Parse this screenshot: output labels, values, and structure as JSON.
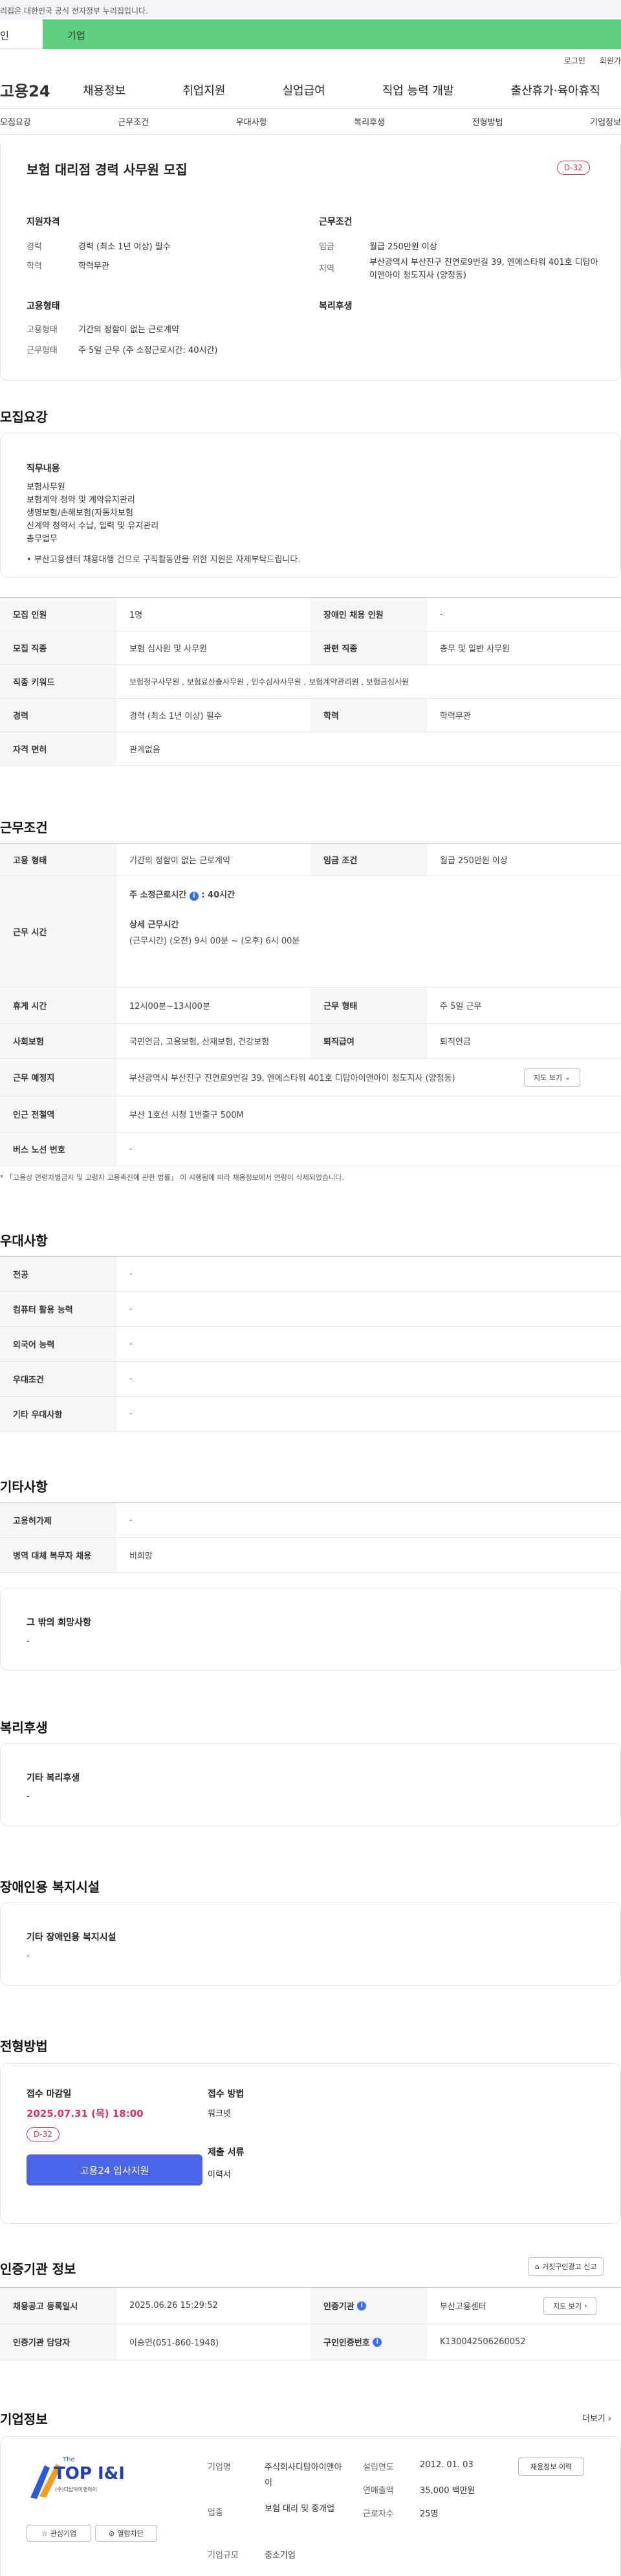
{
  "top": {
    "notice": "리집은 대한민국 공식 전자정부 누리집입니다.",
    "tab_individual": "인",
    "tab_company": "기업"
  },
  "util": {
    "login": "로그인",
    "join": "회원가"
  },
  "gnb": {
    "logo": "고용24",
    "items": [
      "채용정보",
      "취업지원",
      "실업급여",
      "직업 능력 개발",
      "출산휴가·육아휴직"
    ]
  },
  "subnav": [
    "모집요강",
    "근무조건",
    "우대사항",
    "복리후생",
    "전형방법",
    "기업정보"
  ],
  "summary": {
    "title": "보험 대리점 경력 사무원 모집",
    "dday": "D-32",
    "qual_head": "지원자격",
    "career_label": "경력",
    "career_value": "경력 (최소 1년 이상) 필수",
    "edu_label": "학력",
    "edu_value": "학력무관",
    "cond_head": "근무조건",
    "wage_label": "임금",
    "wage_value": "월급 250만원 이상",
    "region_label": "지역",
    "region_value": "부산광역시 부산진구 진연로9번길 39, 엔에스타워 401호 디탑아이앤아이 청도지사 (양정동)",
    "emp_head": "고용형태",
    "emp_label": "고용형태",
    "emp_value": "기간의 정함이 없는 근로계약",
    "hours_label": "근무형태",
    "hours_value": "주 5일 근무 (주 소정근로시간: 40시간)",
    "welfare_head": "복리후생"
  },
  "recruit": {
    "title": "모집요강",
    "duty_head": "직무내용",
    "duties": [
      "보험사무원",
      "보험계약 청약 및 계약유지관리",
      "생명보험/손해보험(자동차보험",
      "신계약 청약서 수납, 입력 및 유지관리",
      "총무업무"
    ],
    "notice": "• 부산고용센터 채용대행 건으로 구직활동만을 위한 지원은 자제부탁드립니다.",
    "rows": [
      [
        "모집 인원",
        "1명",
        "장애인 채용 인원",
        "-"
      ],
      [
        "모집 직종",
        "보험 심사원 및 사무원",
        "관련 직종",
        "총무 및 일반 사무원"
      ],
      [
        "직종 키워드",
        "보험청구사무원 , 보험료산출사무원 , 인수심사사무원 , 보험계약관리원 , 보험금심사원"
      ],
      [
        "경력",
        "경력 (최소 1년 이상) 필수",
        "학력",
        "학력무관"
      ],
      [
        "자격 면허",
        "관계없음"
      ]
    ]
  },
  "work": {
    "title": "근무조건",
    "emp_th": "고용 형태",
    "emp_td": "기간의 정함이 없는 근로계약",
    "wage_th": "임금 조건",
    "wage_td": "월급 250만원 이상",
    "time_th": "근무 시간",
    "time_weekly_label": "주 소정근로시간",
    "time_weekly_value": ": 40시간",
    "time_detail_label": "상세 근무시간",
    "time_detail_value": "(근무시간) (오전) 9시 00분 ~ (오후) 6시 00분",
    "break_th": "휴게 시간",
    "break_td": "12시00분~13시00분",
    "type_th": "근무 형태",
    "type_td": "주 5일 근무",
    "ins_th": "사회보험",
    "ins_td": "국민연금, 고용보험, 산재보험, 건강보험",
    "sev_th": "퇴직급여",
    "sev_td": "퇴직연금",
    "addr_th": "근무 예정지",
    "addr_td": "부산광역시 부산진구 진연로9번길 39, 엔에스타워 401호 디탑아이앤아이 청도지사 (양정동)",
    "map_btn": "지도 보기",
    "subway_th": "인근 전철역",
    "subway_td": "부산 1호선 시청 1번출구 500M",
    "bus_th": "버스 노선 번호",
    "bus_td": "-",
    "law": "* 「고용상 연령차별금지 및 고령자 고용촉진에 관한 법률」 이 시행됨에 따라 채용정보에서 연령이 삭제되었습니다."
  },
  "pref": {
    "title": "우대사항",
    "rows": [
      [
        "전공",
        "-"
      ],
      [
        "컴퓨터 활용 능력",
        "-"
      ],
      [
        "외국어 능력",
        "-"
      ],
      [
        "우대조건",
        "-"
      ],
      [
        "기타 우대사항",
        "-"
      ]
    ]
  },
  "etc": {
    "title": "기타사항",
    "rows": [
      [
        "고용허가제",
        "-"
      ],
      [
        "병역 대체 복무자 채용",
        "비희망"
      ]
    ],
    "hope_head": "그 밖의 희망사항",
    "hope_value": "-"
  },
  "welfare": {
    "title": "복리후생",
    "head": "기타 복리후생",
    "value": "-"
  },
  "disab": {
    "title": "장애인용 복지시설",
    "head": "기타 장애인용 복지시설",
    "value": "-"
  },
  "process": {
    "title": "전형방법",
    "deadline_label": "접수 마감일",
    "deadline_value": "2025.07.31 (목) 18:00",
    "dday": "D-32",
    "apply_btn": "고용24 입사지원",
    "method_label": "접수 방법",
    "method_value": "워크넷",
    "docs_label": "제출 서류",
    "docs_value": "이력서"
  },
  "cert": {
    "title": "인증기관 정보",
    "report_btn": "거짓구인광고 신고",
    "reg_th": "채용공고 등록일시",
    "reg_td": "2025.06.26 15:29:52",
    "org_th": "인증기관",
    "org_td": "부산고용센터",
    "map_btn": "지도 보기",
    "mgr_th": "인증기관 담당자",
    "mgr_td": "이승연(051-860-1948)",
    "no_th": "구인인증번호",
    "no_td": "K130042506260052"
  },
  "company": {
    "title": "기업정보",
    "more": "더보기",
    "logo_small": "The",
    "logo_main": "TOP I&I",
    "logo_sub": "(주)디탑아이앤아이",
    "interest_btn": "관심기업",
    "block_btn": "열람차단",
    "name_label": "기업명",
    "name_value": "주식회사디탑아이앤아이",
    "ind_label": "업종",
    "ind_value": "보험 대리 및 중개업",
    "size_label": "기업규모",
    "size_value": "중소기업",
    "est_label": "설립연도",
    "est_value": "2012. 01. 03",
    "sales_label": "연매출액",
    "sales_value": "35,000 백만원",
    "emp_label": "근로자수",
    "emp_value": "25명",
    "jobs_btn": "채용정보 이력"
  },
  "colors": {
    "accent": "#5fce7e",
    "brand_blue": "#4a63e7",
    "dday": "#e0305f"
  }
}
